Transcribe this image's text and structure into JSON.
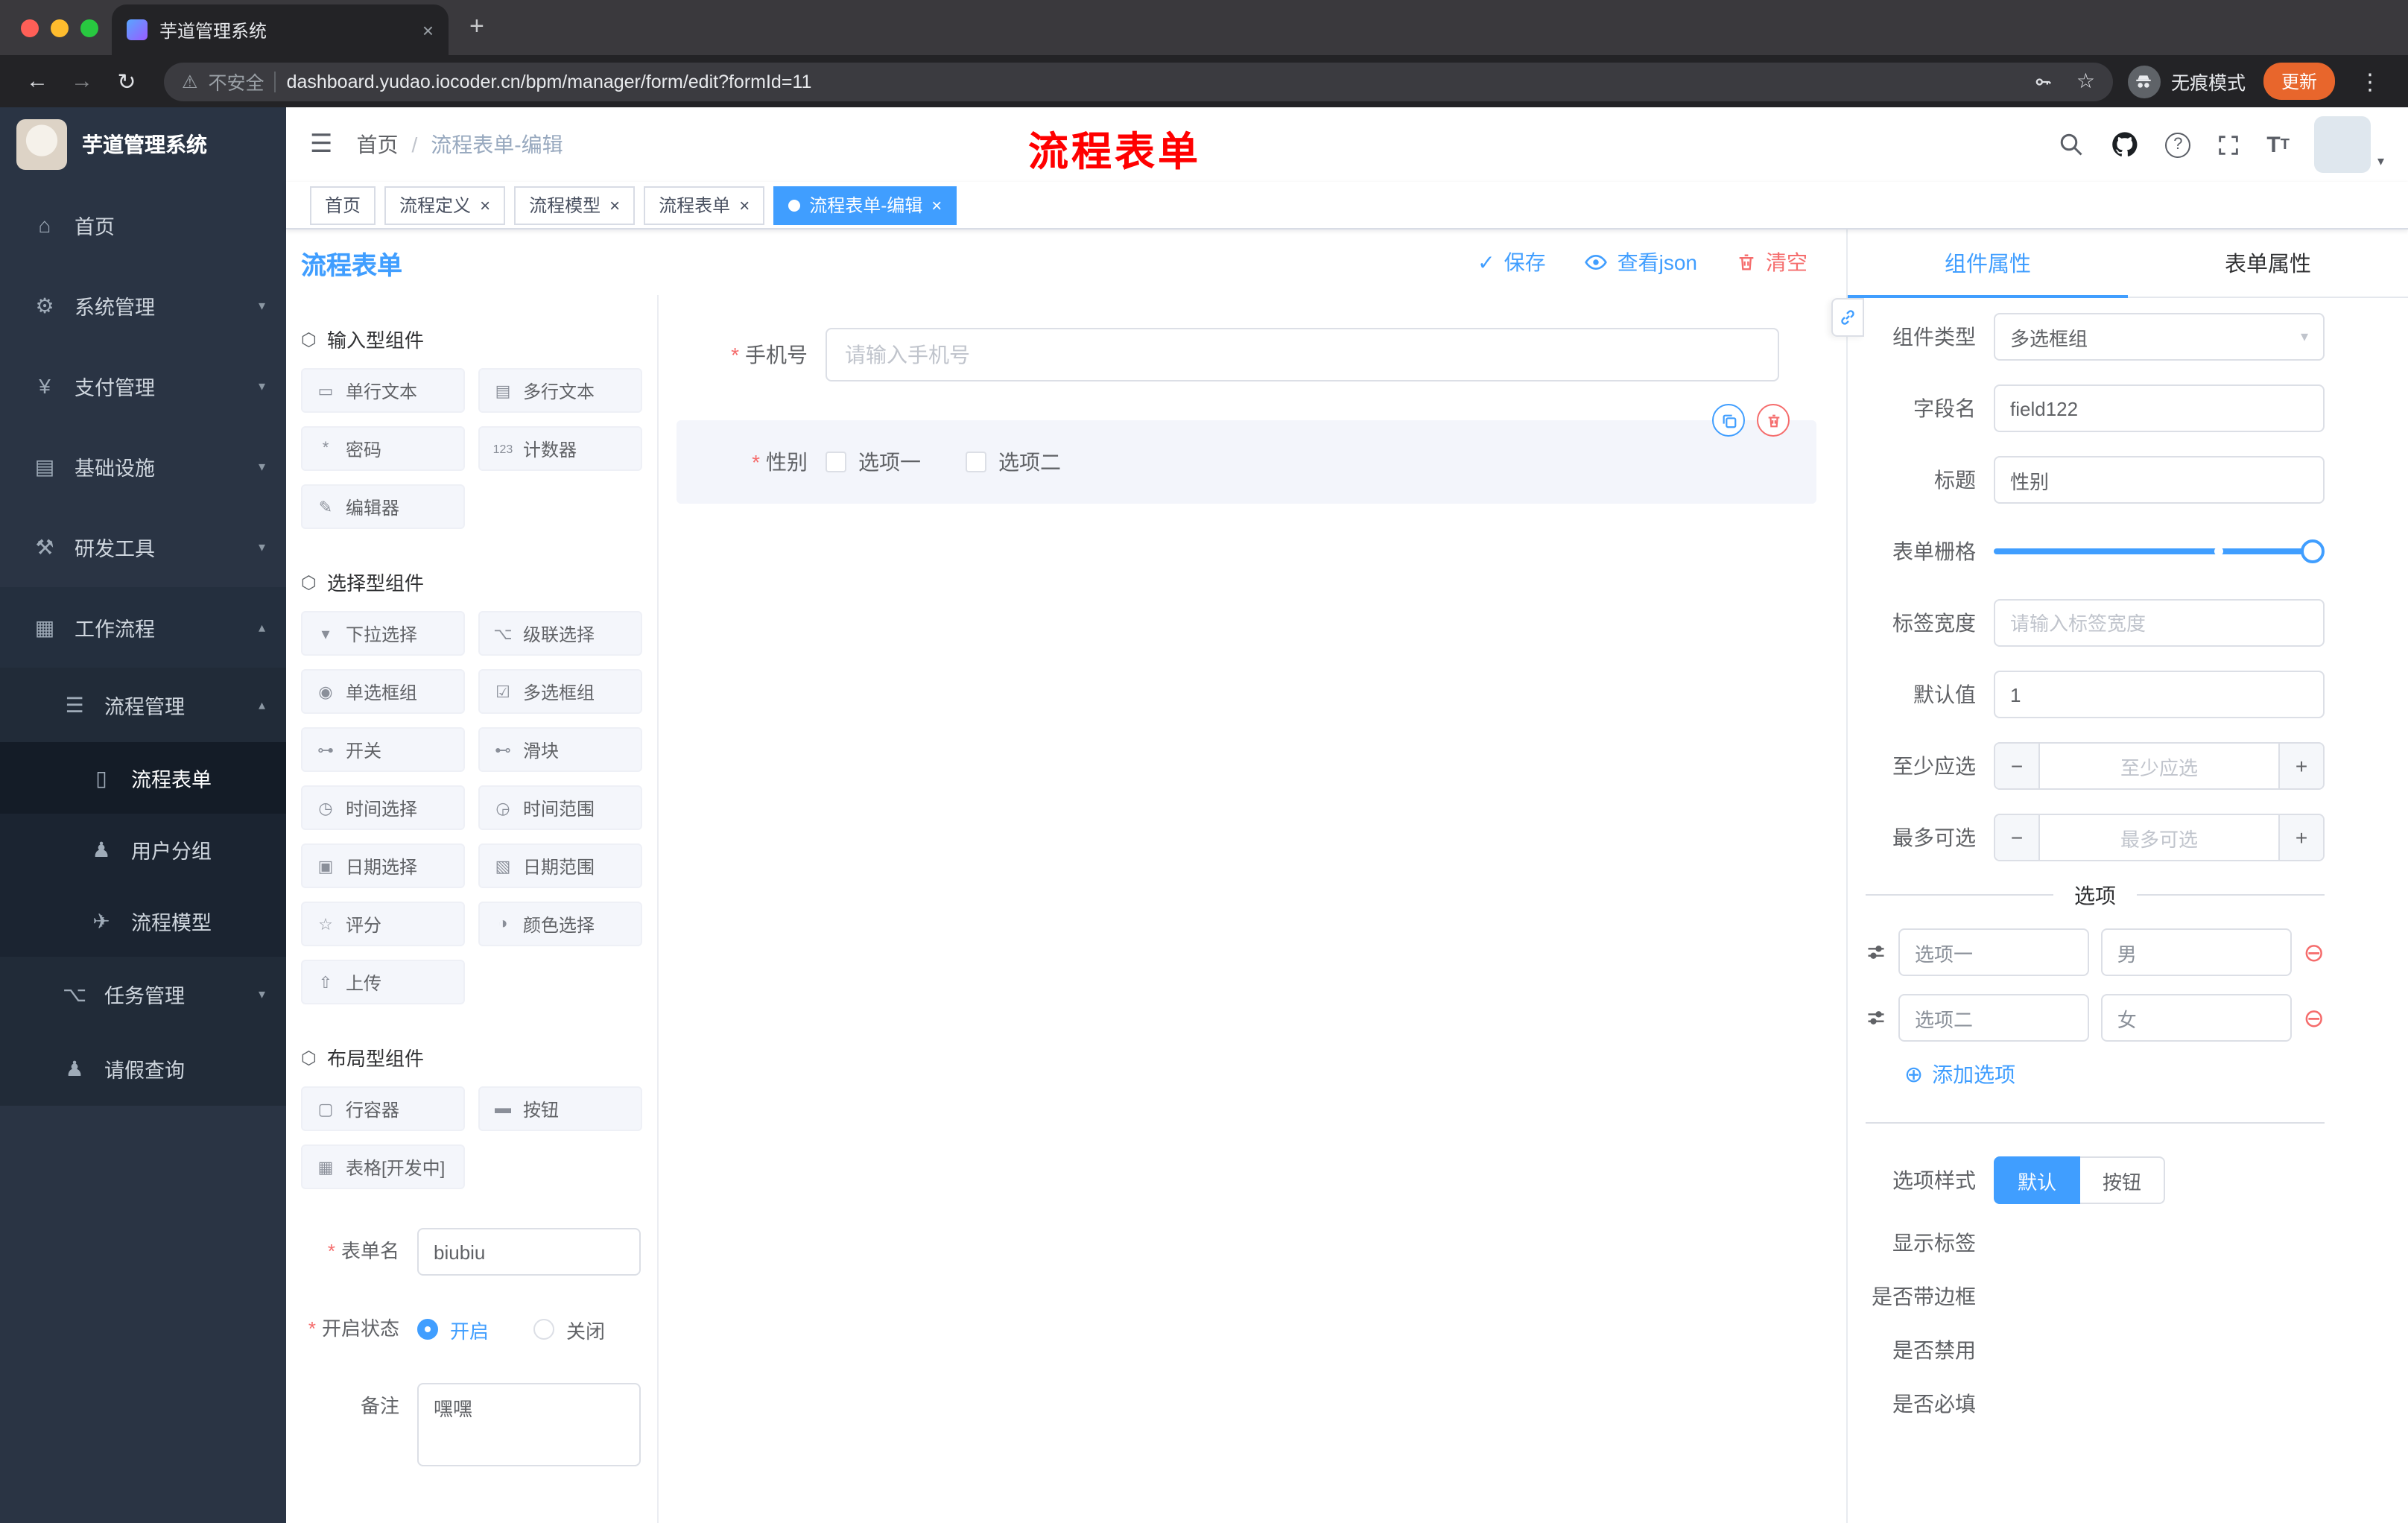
{
  "colors": {
    "accent": "#409eff",
    "danger": "#f56c6c",
    "annotation": "#ff0000",
    "sidebar_bg": "#2a3444",
    "active_tag": "#409eff"
  },
  "icons": {
    "back": "←",
    "forward": "→",
    "reload": "↻",
    "warning": "⚠",
    "star": "☆",
    "kebab": "⋮",
    "close": "×",
    "new_tab": "+",
    "hamburger": "☰",
    "check": "✓",
    "select_caret": "▾",
    "minus": "−",
    "plus": "+",
    "add_circle": "⊕",
    "remove_circle": "⊖",
    "avatar_caret": "▾",
    "help": "?",
    "section": "⬡"
  },
  "browser": {
    "tab_title": "芋道管理系统",
    "security_label": "不安全",
    "url": "dashboard.yudao.iocoder.cn/bpm/manager/form/edit?formId=11",
    "incognito_label": "无痕模式",
    "update_label": "更新"
  },
  "sidebar": {
    "logo_title": "芋道管理系统",
    "items": [
      {
        "label": "首页",
        "icon": "⌂",
        "level": 1
      },
      {
        "label": "系统管理",
        "icon": "⚙",
        "level": 1,
        "chevron": "▾"
      },
      {
        "label": "支付管理",
        "icon": "¥",
        "level": 1,
        "chevron": "▾"
      },
      {
        "label": "基础设施",
        "icon": "▤",
        "level": 1,
        "chevron": "▾"
      },
      {
        "label": "研发工具",
        "icon": "⚒",
        "level": 1,
        "chevron": "▾"
      },
      {
        "label": "工作流程",
        "icon": "▦",
        "level": 1,
        "chevron": "▴"
      },
      {
        "label": "流程管理",
        "icon": "☰",
        "level": 2,
        "chevron": "▴"
      },
      {
        "label": "流程表单",
        "icon": "▯",
        "level": 3,
        "active": true
      },
      {
        "label": "用户分组",
        "icon": "♟",
        "level": 3
      },
      {
        "label": "流程模型",
        "icon": "✈",
        "level": 3
      },
      {
        "label": "任务管理",
        "icon": "⌥",
        "level": 2,
        "chevron": "▾"
      },
      {
        "label": "请假查询",
        "icon": "♟",
        "level": 2
      }
    ]
  },
  "header": {
    "breadcrumb_home": "首页",
    "breadcrumb_sep": "/",
    "breadcrumb_current": "流程表单-编辑",
    "annotation": "流程表单"
  },
  "tags": [
    {
      "label": "首页"
    },
    {
      "label": "流程定义"
    },
    {
      "label": "流程模型"
    },
    {
      "label": "流程表单"
    },
    {
      "label": "流程表单-编辑",
      "active": true
    }
  ],
  "board": {
    "title": "流程表单",
    "save": "保存",
    "view_json": "查看json",
    "clear": "清空"
  },
  "palette": {
    "sections": [
      {
        "title": "输入型组件",
        "items": [
          {
            "label": "单行文本",
            "icon": "▭"
          },
          {
            "label": "多行文本",
            "icon": "▤"
          },
          {
            "label": "密码",
            "icon": "*"
          },
          {
            "label": "计数器",
            "icon": "123"
          },
          {
            "label": "编辑器",
            "icon": "✎"
          }
        ]
      },
      {
        "title": "选择型组件",
        "items": [
          {
            "label": "下拉选择",
            "icon": "▾"
          },
          {
            "label": "级联选择",
            "icon": "⌥"
          },
          {
            "label": "单选框组",
            "icon": "◉"
          },
          {
            "label": "多选框组",
            "icon": "☑"
          },
          {
            "label": "开关",
            "icon": "⊶"
          },
          {
            "label": "滑块",
            "icon": "⊷"
          },
          {
            "label": "时间选择",
            "icon": "◷"
          },
          {
            "label": "时间范围",
            "icon": "◶"
          },
          {
            "label": "日期选择",
            "icon": "▣"
          },
          {
            "label": "日期范围",
            "icon": "▧"
          },
          {
            "label": "评分",
            "icon": "☆"
          },
          {
            "label": "颜色选择",
            "icon": "◑"
          },
          {
            "label": "上传",
            "icon": "⇧"
          }
        ]
      },
      {
        "title": "布局型组件",
        "items": [
          {
            "label": "行容器",
            "icon": "▢"
          },
          {
            "label": "按钮",
            "icon": "▬"
          },
          {
            "label": "表格[开发中]",
            "icon": "▦"
          }
        ]
      }
    ],
    "form": {
      "name_label": "表单名",
      "name_value": "biubiu",
      "status_label": "开启状态",
      "status_on": "开启",
      "status_off": "关闭",
      "remark_label": "备注",
      "remark_value": "嘿嘿"
    }
  },
  "canvas": {
    "phone_label": "手机号",
    "phone_placeholder": "请输入手机号",
    "gender_label": "性别",
    "gender_options": [
      {
        "label": "选项一"
      },
      {
        "label": "选项二"
      }
    ]
  },
  "props": {
    "tab_component": "组件属性",
    "tab_form": "表单属性",
    "type_label": "组件类型",
    "type_value": "多选框组",
    "field_label": "字段名",
    "field_value": "field122",
    "title_label": "标题",
    "title_value": "性别",
    "grid_label": "表单栅格",
    "label_width_label": "标签宽度",
    "label_width_placeholder": "请输入标签宽度",
    "default_label": "默认值",
    "default_value": "1",
    "min_label": "至少应选",
    "min_placeholder": "至少应选",
    "max_label": "最多可选",
    "max_placeholder": "最多可选",
    "options_divider": "选项",
    "options": [
      {
        "name": "选项一",
        "value": "男"
      },
      {
        "name": "选项二",
        "value": "女"
      }
    ],
    "add_option_label": "添加选项",
    "style_label": "选项样式",
    "style_default": "默认",
    "style_button": "按钮",
    "switch_show_label": "显示标签",
    "switch_border": "是否带边框",
    "switch_disabled": "是否禁用",
    "switch_required": "是否必填"
  }
}
